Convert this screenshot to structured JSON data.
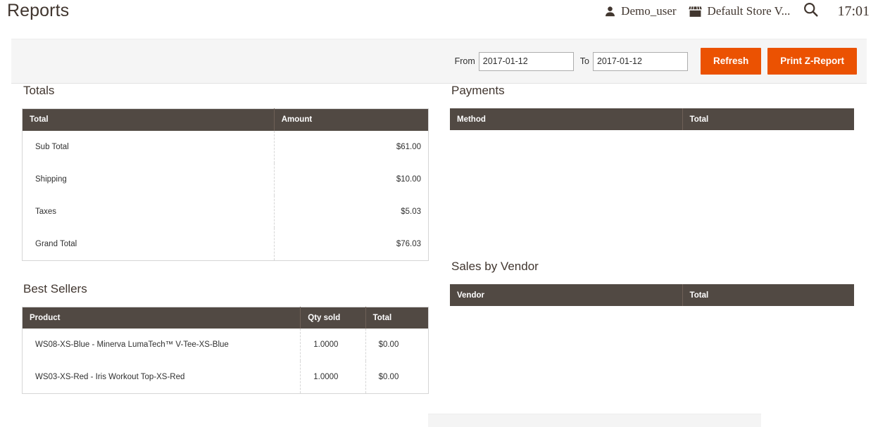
{
  "header": {
    "page_title": "Reports",
    "user": {
      "icon": "user-icon",
      "name": "Demo_user"
    },
    "store": {
      "icon": "store-icon",
      "name": "Default Store V..."
    },
    "search": {
      "icon": "search-icon"
    },
    "time": "17:01"
  },
  "toolbar": {
    "from_label": "From",
    "from_value": "2017-01-12",
    "from_placeholder": "yyyy-mm-dd",
    "to_label": "To",
    "to_value": "2017-01-12",
    "to_placeholder": "yyyy-mm-dd",
    "refresh_label": "Refresh",
    "print_label": "Print Z-Report",
    "accent_color": "#eb5202"
  },
  "sections": {
    "totals": {
      "title": "Totals",
      "columns": [
        "Total",
        "Amount"
      ],
      "rows": [
        {
          "label": "Sub Total",
          "amount": "$61.00"
        },
        {
          "label": "Shipping",
          "amount": "$10.00"
        },
        {
          "label": "Taxes",
          "amount": "$5.03"
        },
        {
          "label": "Grand Total",
          "amount": "$76.03"
        }
      ]
    },
    "payments": {
      "title": "Payments",
      "columns": [
        "Method",
        "Total"
      ],
      "rows": []
    },
    "best_sellers": {
      "title": "Best Sellers",
      "columns": [
        "Product",
        "Qty sold",
        "Total"
      ],
      "rows": [
        {
          "product": "WS08-XS-Blue - Minerva LumaTech™ V-Tee-XS-Blue",
          "qty": "1.0000",
          "total": "$0.00"
        },
        {
          "product": "WS03-XS-Red - Iris Workout Top-XS-Red",
          "qty": "1.0000",
          "total": "$0.00"
        }
      ]
    },
    "sales_by_vendor": {
      "title": "Sales by Vendor",
      "columns": [
        "Vendor",
        "Total"
      ],
      "rows": []
    }
  },
  "theme": {
    "table_header_bg": "#514943",
    "toolbar_bg": "#f5f5f5",
    "text_color": "#303030",
    "title_color": "#41362f"
  }
}
